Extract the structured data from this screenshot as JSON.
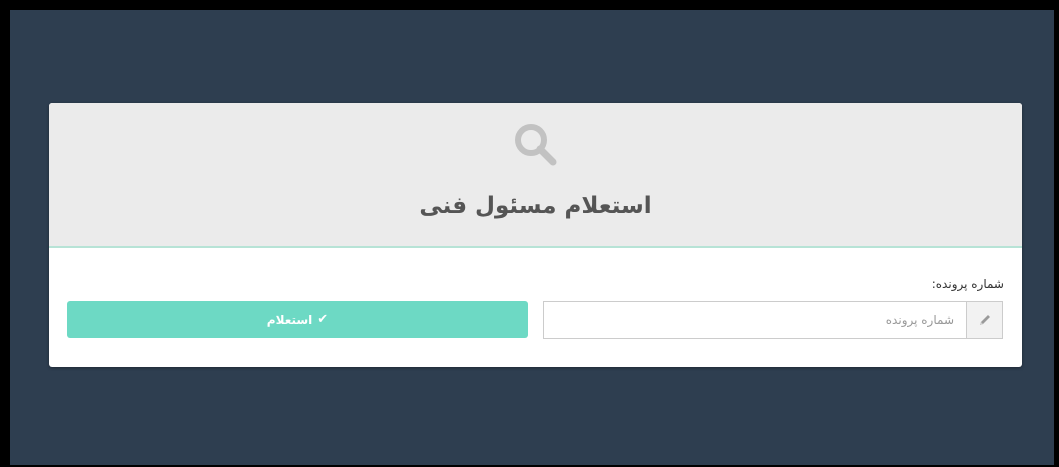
{
  "page": {
    "title": "استعلام مسئول فنی"
  },
  "form": {
    "field_label": "شماره پرونده:",
    "file_number_value": "",
    "file_number_placeholder": "شماره پرونده",
    "submit_label": "استعلام",
    "submit_icon": "✔"
  },
  "icons": {
    "header": "search-icon",
    "input_addon": "pencil-icon",
    "button": "check-icon"
  },
  "colors": {
    "background": "#2e3e50",
    "header_background": "#ebebeb",
    "header_border": "#b7e3d6",
    "button": "#6dd9c4",
    "icon": "#c2c2c2"
  }
}
